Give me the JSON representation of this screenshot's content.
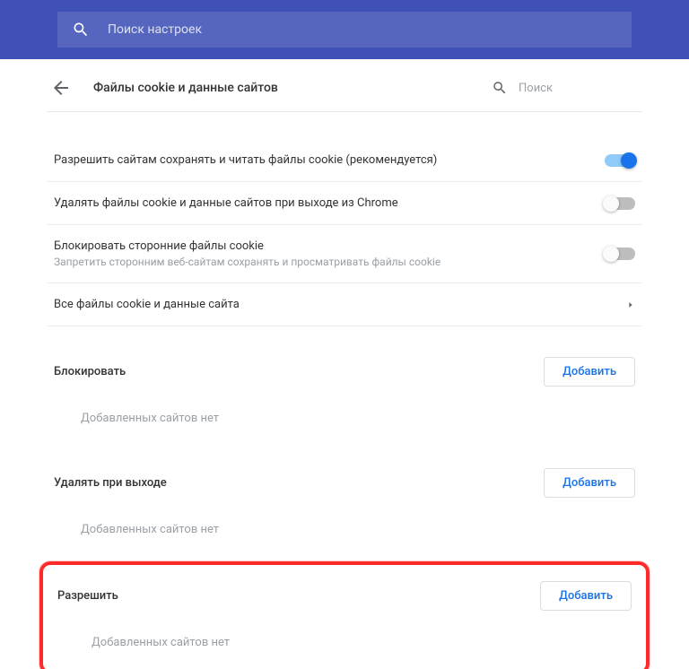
{
  "topbar": {
    "search_placeholder": "Поиск настроек"
  },
  "header": {
    "title": "Файлы cookie и данные сайтов",
    "search_placeholder": "Поиск"
  },
  "settings": {
    "allow_cookies": {
      "label": "Разрешить сайтам сохранять и читать файлы cookie (рекомендуется)",
      "on": true
    },
    "clear_on_exit": {
      "label": "Удалять файлы cookie и данные сайтов при выходе из Chrome",
      "on": false
    },
    "block_third_party": {
      "label": "Блокировать сторонние файлы cookie",
      "sub": "Запретить сторонним веб-сайтам сохранять и просматривать файлы cookie",
      "on": false
    },
    "all_cookies": {
      "label": "Все файлы cookie и данные сайта"
    }
  },
  "sections": {
    "block": {
      "title": "Блокировать",
      "add": "Добавить",
      "empty": "Добавленных сайтов нет"
    },
    "remove": {
      "title": "Удалять при выходе",
      "add": "Добавить",
      "empty": "Добавленных сайтов нет"
    },
    "allow": {
      "title": "Разрешить",
      "add": "Добавить",
      "empty": "Добавленных сайтов нет"
    }
  }
}
